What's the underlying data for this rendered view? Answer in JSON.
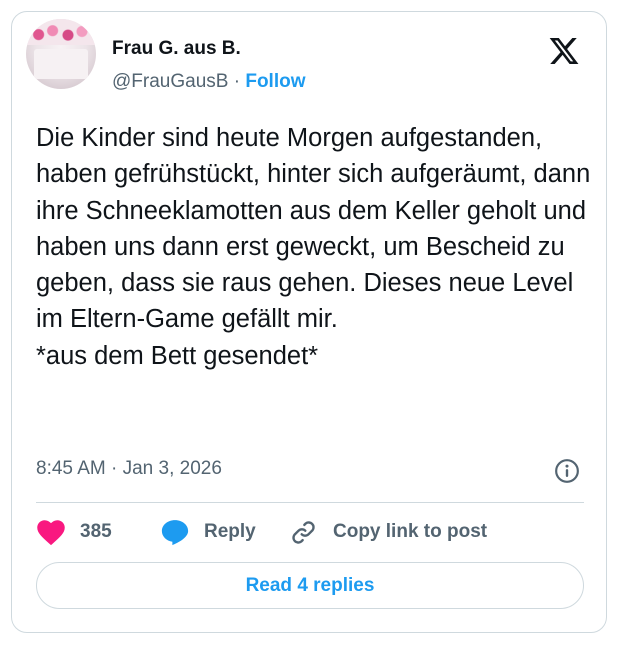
{
  "author": {
    "name": "Frau G. aus B.",
    "handle": "@FrauGausB",
    "separator": "·",
    "follow_label": "Follow"
  },
  "icons": {
    "logo": "x-logo-icon",
    "info": "info-icon",
    "like": "heart-icon",
    "reply": "speech-bubble-icon",
    "copy": "link-icon"
  },
  "tweet": {
    "text": "Die Kinder sind heute Morgen aufgestanden, haben gefrühstückt, hinter sich aufgeräumt, dann ihre Schneeklamotten aus dem Keller geholt und haben uns dann erst geweckt, um Bescheid zu geben, dass sie raus gehen. Dieses neue Level im Eltern-Game gefällt mir.\n*aus dem Bett gesendet*",
    "timestamp": "8:45 AM · Jan 3, 2026"
  },
  "actions": {
    "like_count": "385",
    "reply_label": "Reply",
    "copy_label": "Copy link to post",
    "read_replies_label": "Read 4 replies"
  },
  "colors": {
    "accent": "#1d9bf0",
    "like": "#f91880",
    "text": "#0f1419",
    "secondary": "#536471",
    "border": "#cfd9de"
  }
}
